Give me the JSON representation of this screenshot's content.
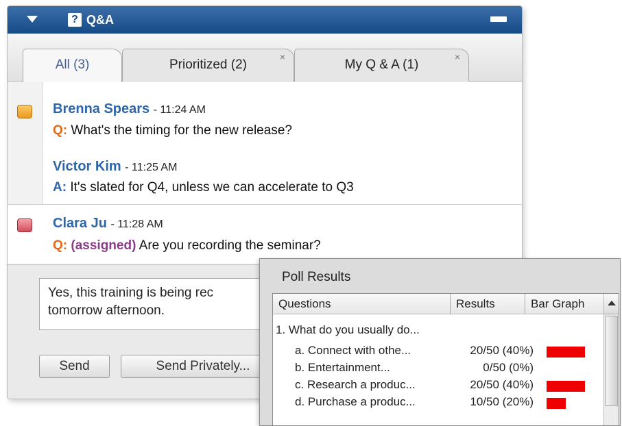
{
  "qa": {
    "title": "Q&A",
    "tabs": [
      {
        "label": "All (3)"
      },
      {
        "label": "Prioritized (2)"
      },
      {
        "label": "My Q & A (1)"
      }
    ],
    "messages": [
      {
        "author": "Brenna Spears",
        "time": "- 11:24 AM",
        "prefix": "Q:",
        "text": "What's the timing for the new  release?"
      },
      {
        "author": "Victor Kim",
        "time": "- 11:25 AM",
        "prefix": "A:",
        "text": "It's slated for Q4, unless we can accelerate to Q3"
      },
      {
        "author": "Clara Ju",
        "time": "- 11:28 AM",
        "prefix": "Q:",
        "tag": "(assigned)",
        "text": "Are you recording the seminar?"
      }
    ],
    "reply_text_line1": "Yes, this training is being rec",
    "reply_text_line2": "tomorrow afternoon.",
    "send_label": "Send",
    "send_privately_label": "Send Privately..."
  },
  "poll": {
    "title": "Poll Results",
    "columns": [
      "Questions",
      "Results",
      "Bar Graph"
    ],
    "question": "1. What do you usually do...",
    "options": [
      {
        "label": "a. Connect with othe...",
        "result": "20/50 (40%)",
        "fraction": 0.4
      },
      {
        "label": "b. Entertainment...",
        "result": "0/50 (0%)",
        "fraction": 0.0
      },
      {
        "label": "c. Research a produc...",
        "result": "20/50 (40%)",
        "fraction": 0.4
      },
      {
        "label": "d. Purchase a produc...",
        "result": "10/50 (20%)",
        "fraction": 0.2
      }
    ],
    "bar_color": "#ee0000"
  },
  "colors": {
    "title_bar": "#164a86",
    "author": "#2e66a8",
    "question_prefix": "#e56a17",
    "assigned_tag": "#8a3e8a"
  }
}
